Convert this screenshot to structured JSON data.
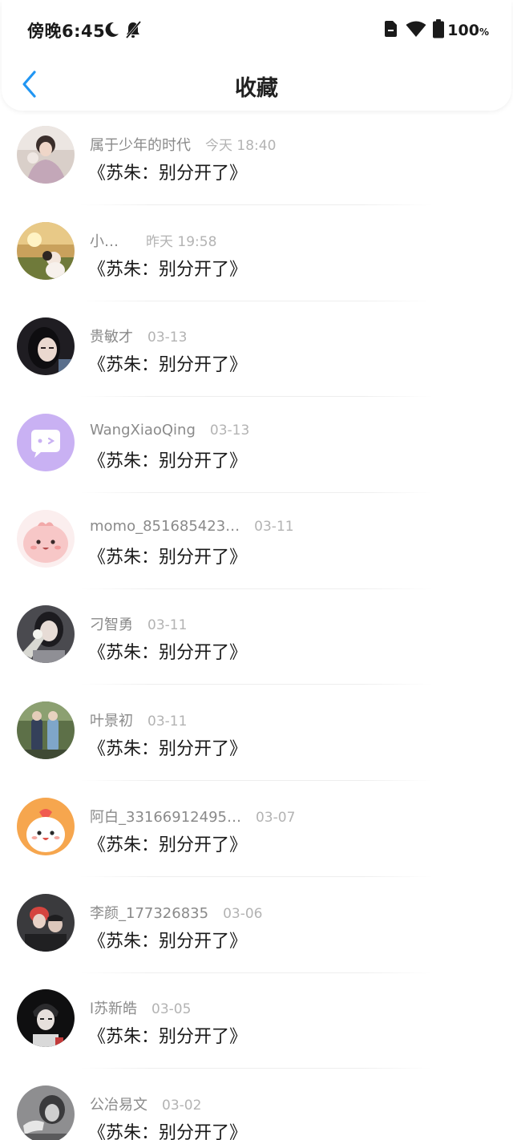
{
  "status_bar": {
    "time": "傍晚6:45",
    "battery": "100",
    "battery_unit": "%",
    "icons": [
      "moon-icon",
      "bell-off-icon",
      "sim-card-icon",
      "wifi-icon",
      "battery-icon"
    ]
  },
  "header": {
    "title": "收藏",
    "back_icon": "chevron-left-icon",
    "accent_color": "#2196F3"
  },
  "favorites": [
    {
      "user": "属于少年的时代",
      "time": "今天 18:40",
      "title": "《苏朱：别分开了》",
      "avatar": "photo-person-light"
    },
    {
      "user": "小…",
      "time": "昨天 19:58",
      "title": "《苏朱：别分开了》",
      "avatar": "photo-sunset-park"
    },
    {
      "user": "贵敏才",
      "time": "03-13",
      "title": "《苏朱：别分开了》",
      "avatar": "photo-girl-dark"
    },
    {
      "user": "WangXiaoQing",
      "time": "03-13",
      "title": "《苏朱：别分开了》",
      "avatar": "default-chat-avatar"
    },
    {
      "user": "momo_851685423…",
      "time": "03-11",
      "title": "《苏朱：别分开了》",
      "avatar": "cartoon-pink"
    },
    {
      "user": "刁智勇",
      "time": "03-11",
      "title": "《苏朱：别分开了》",
      "avatar": "photo-girl-flower"
    },
    {
      "user": "叶景初",
      "time": "03-11",
      "title": "《苏朱：别分开了》",
      "avatar": "photo-two-men"
    },
    {
      "user": "阿白_33166912495…",
      "time": "03-07",
      "title": "《苏朱：别分开了》",
      "avatar": "cartoon-orange"
    },
    {
      "user": "李颜_177326835",
      "time": "03-06",
      "title": "《苏朱：别分开了》",
      "avatar": "photo-red-hair"
    },
    {
      "user": "l苏新皓",
      "time": "03-05",
      "title": "《苏朱：别分开了》",
      "avatar": "photo-bw-man"
    },
    {
      "user": "公冶易文",
      "time": "03-02",
      "title": "《苏朱：别分开了》",
      "avatar": "photo-bw-hand"
    }
  ]
}
